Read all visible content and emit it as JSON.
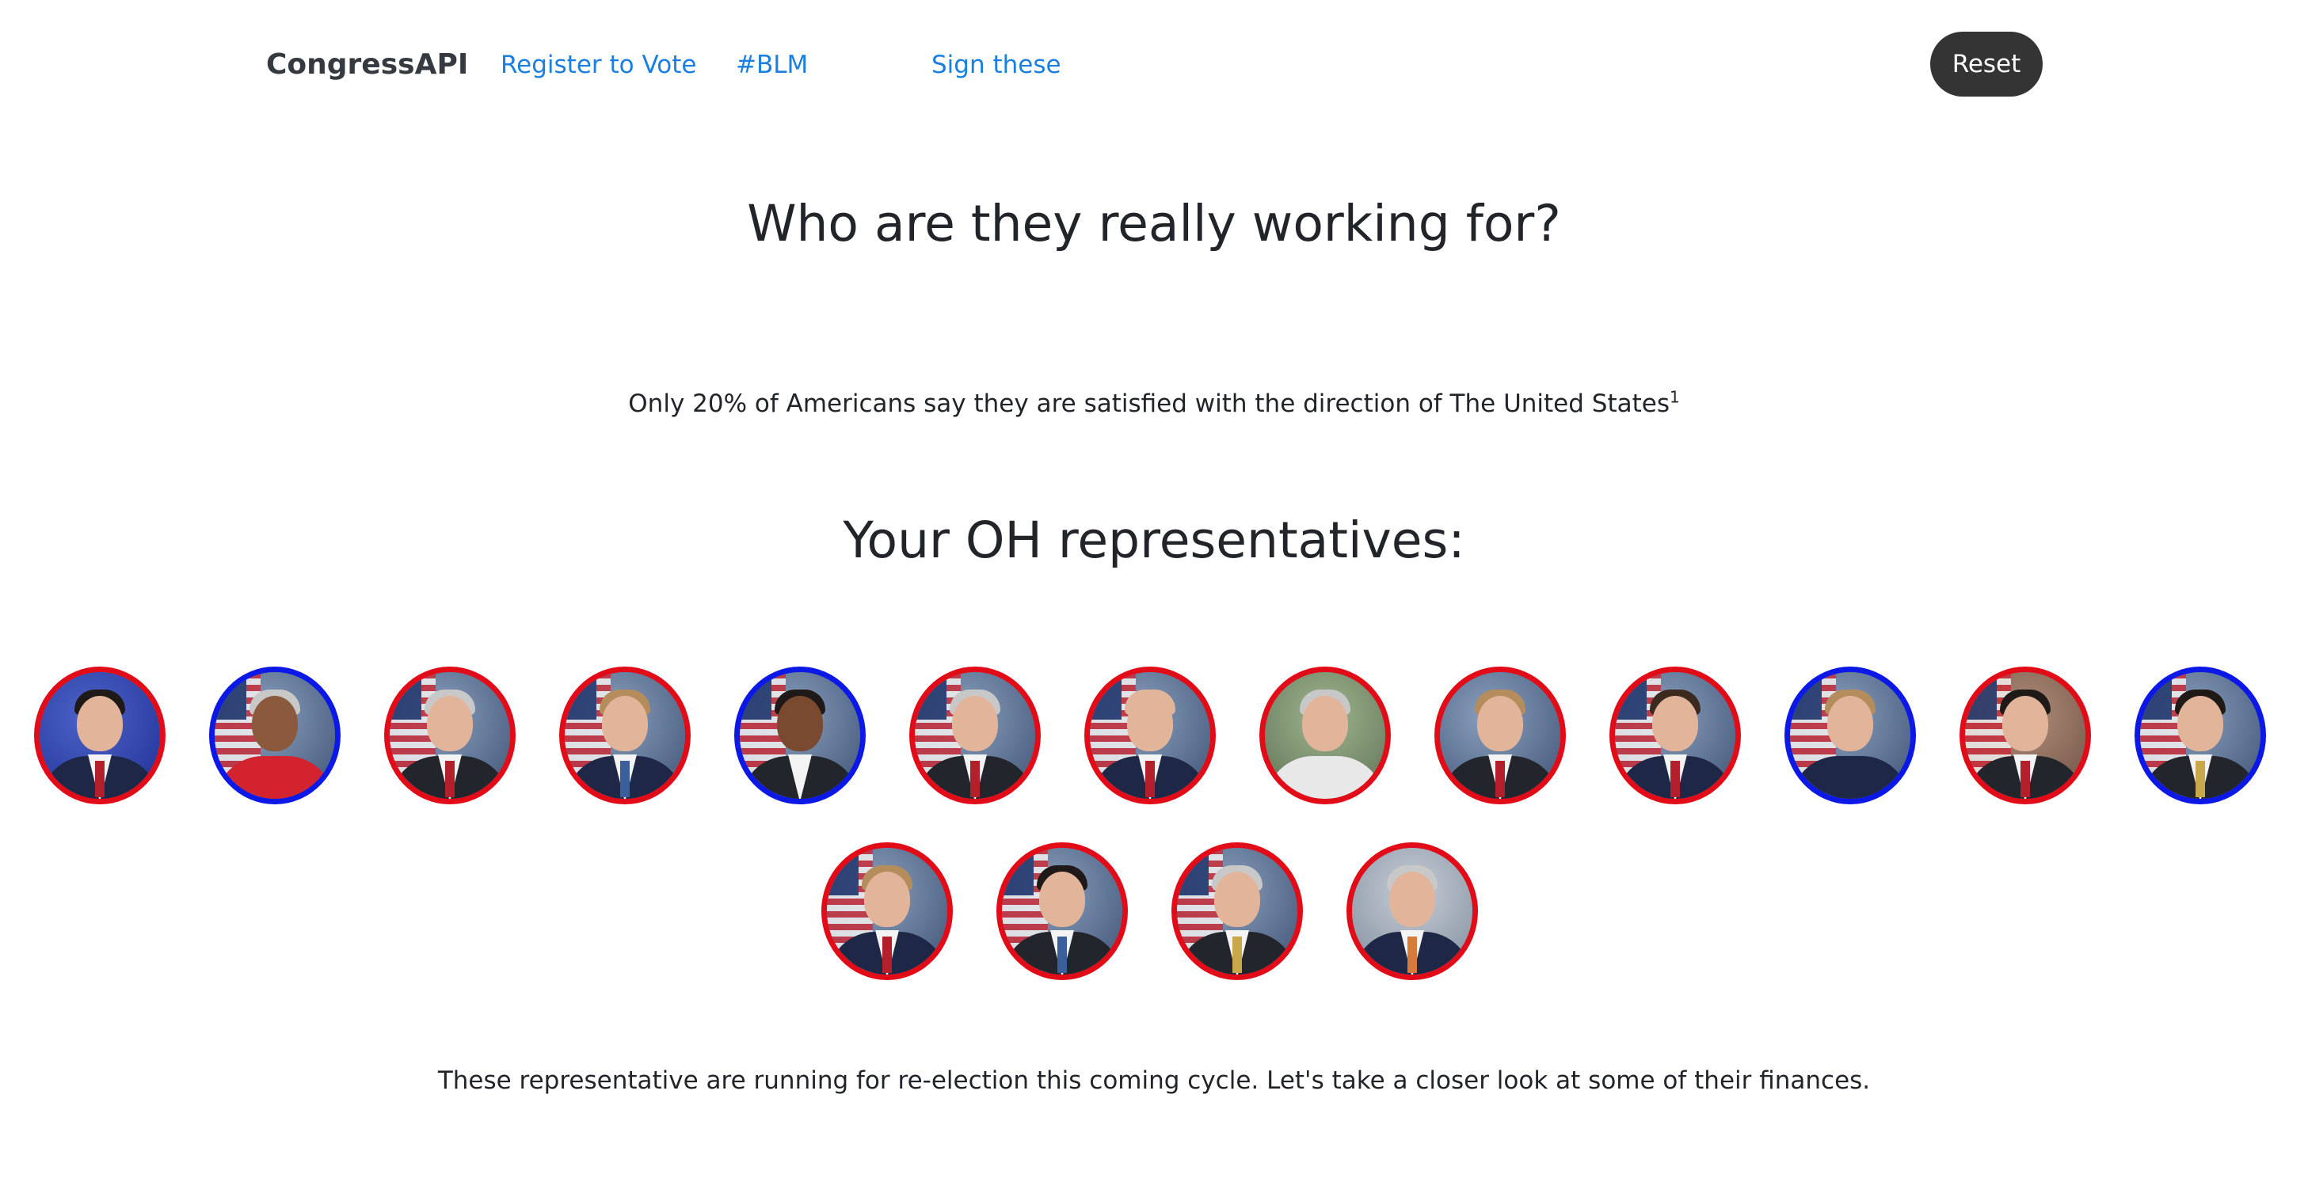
{
  "navbar": {
    "brand": "CongressAPI",
    "links": [
      {
        "label": "Register to Vote"
      },
      {
        "label": "#BLM"
      },
      {
        "label": "Sign these"
      }
    ],
    "reset_label": "Reset"
  },
  "main": {
    "title": "Who are they really working for?",
    "stat_text": "Only 20% of Americans say they are satisfied with the direction of The United States",
    "stat_footnote": "1",
    "reps_title": "Your OH representatives:",
    "footer_text": "These representative are running for re-election this coming cycle. Let's take a closer look at some of their finances."
  },
  "representatives": [
    {
      "party": "republican",
      "border_color": "#e10c18"
    },
    {
      "party": "democrat",
      "border_color": "#0c18e6"
    },
    {
      "party": "republican",
      "border_color": "#e10c18"
    },
    {
      "party": "republican",
      "border_color": "#e10c18"
    },
    {
      "party": "democrat",
      "border_color": "#0c18e6"
    },
    {
      "party": "republican",
      "border_color": "#e10c18"
    },
    {
      "party": "republican",
      "border_color": "#e10c18"
    },
    {
      "party": "republican",
      "border_color": "#e10c18"
    },
    {
      "party": "republican",
      "border_color": "#e10c18"
    },
    {
      "party": "republican",
      "border_color": "#e10c18"
    },
    {
      "party": "democrat",
      "border_color": "#0c18e6"
    },
    {
      "party": "republican",
      "border_color": "#e10c18"
    },
    {
      "party": "democrat",
      "border_color": "#0c18e6"
    },
    {
      "party": "republican",
      "border_color": "#e10c18"
    },
    {
      "party": "republican",
      "border_color": "#e10c18"
    },
    {
      "party": "republican",
      "border_color": "#e10c18"
    },
    {
      "party": "republican",
      "border_color": "#e10c18"
    }
  ],
  "colors": {
    "link": "#1a7fe0",
    "reset_button_bg": "#343434",
    "republican_border": "#e10c18",
    "democrat_border": "#0c18e6"
  }
}
